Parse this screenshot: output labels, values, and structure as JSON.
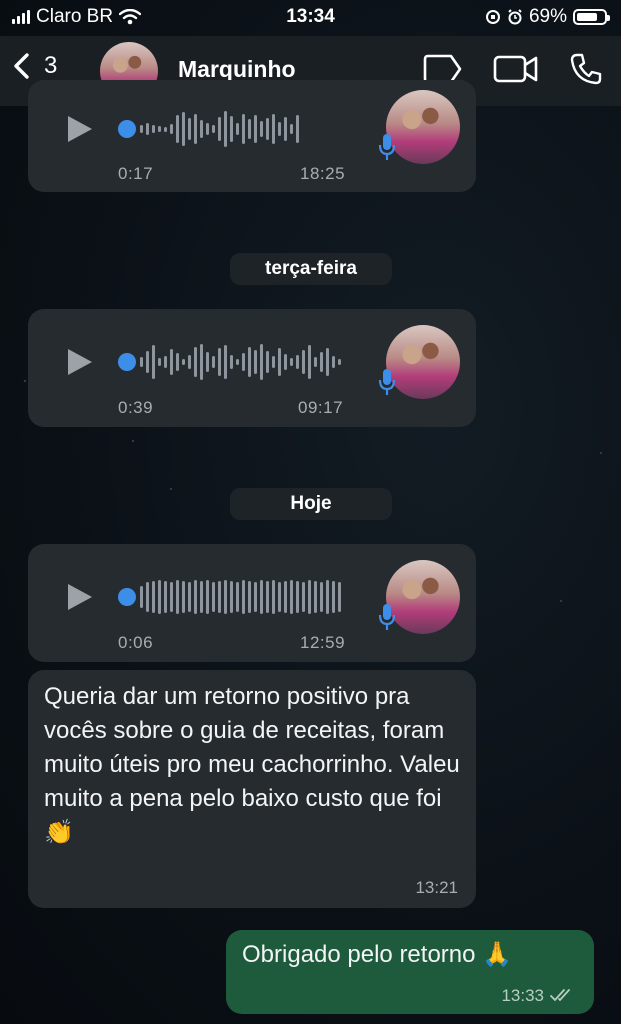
{
  "status": {
    "carrier": "Claro BR",
    "time": "13:34",
    "battery": "69%",
    "battery_level": 0.69
  },
  "header": {
    "back_count": "3",
    "contact_name": "Marquinho"
  },
  "messages": [
    {
      "type": "voice",
      "elapsed": "0:17",
      "sent_time": "18:25"
    },
    {
      "type": "date",
      "label": "terça-feira"
    },
    {
      "type": "voice",
      "elapsed": "0:39",
      "sent_time": "09:17"
    },
    {
      "type": "date",
      "label": "Hoje"
    },
    {
      "type": "voice",
      "elapsed": "0:06",
      "sent_time": "12:59"
    },
    {
      "type": "text",
      "direction": "in",
      "text": "Queria dar um retorno positivo pra vocês sobre o guia de receitas, foram muito úteis pro meu cachorrinho. Valeu muito a pena pelo baixo custo que foi 👏",
      "time": "13:21"
    },
    {
      "type": "text",
      "direction": "out",
      "text": "Obrigado pelo retorno 🙏",
      "time": "13:33"
    }
  ],
  "colors": {
    "incoming_bubble": "#262b30",
    "outgoing_bubble": "#1d5b3c",
    "accent_blue": "#3d8ee8"
  }
}
